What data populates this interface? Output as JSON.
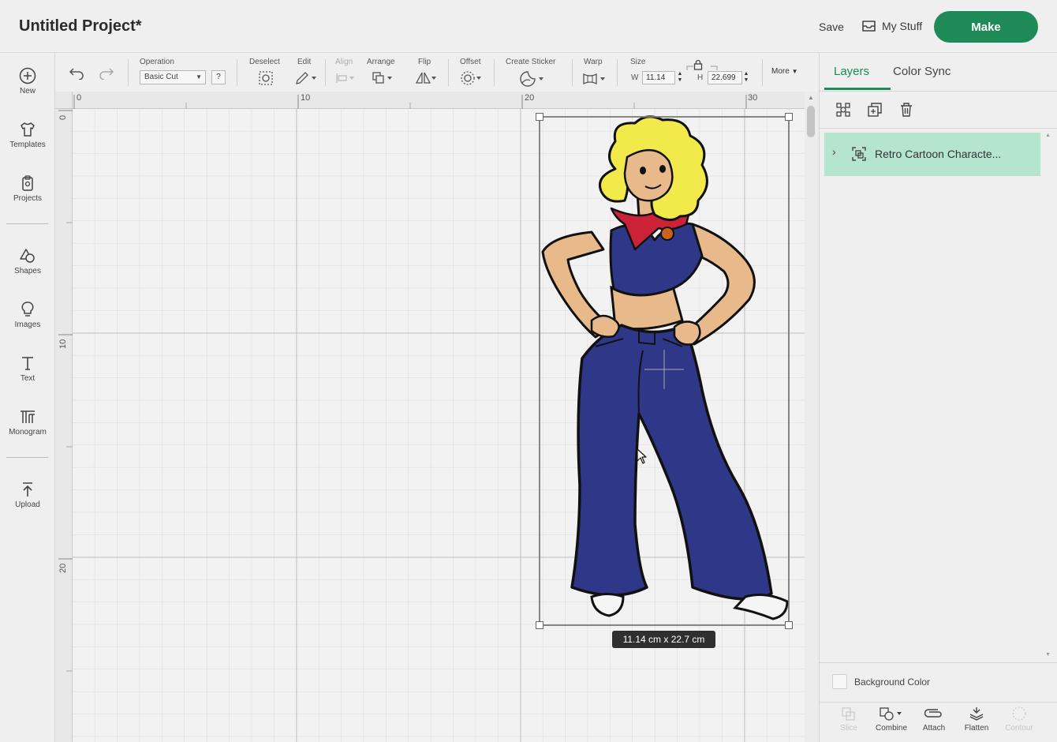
{
  "header": {
    "title": "Untitled Project*",
    "save_label": "Save",
    "mystuff_label": "My Stuff",
    "make_label": "Make",
    "accent_color": "#1d8a57"
  },
  "sidebar": {
    "items": [
      {
        "label": "New",
        "icon": "plus-circle-icon"
      },
      {
        "label": "Templates",
        "icon": "tshirt-icon"
      },
      {
        "label": "Projects",
        "icon": "clipboard-icon"
      },
      {
        "label": "Shapes",
        "icon": "shapes-icon"
      },
      {
        "label": "Images",
        "icon": "lightbulb-icon"
      },
      {
        "label": "Text",
        "icon": "text-t-icon"
      },
      {
        "label": "Monogram",
        "icon": "monogram-icon"
      },
      {
        "label": "Upload",
        "icon": "upload-icon"
      }
    ]
  },
  "toolbar": {
    "operation_label": "Operation",
    "operation_value": "Basic Cut",
    "help_label": "?",
    "deselect_label": "Deselect",
    "edit_label": "Edit",
    "align_label": "Align",
    "arrange_label": "Arrange",
    "flip_label": "Flip",
    "offset_label": "Offset",
    "create_sticker_label": "Create Sticker",
    "warp_label": "Warp",
    "size_label": "Size",
    "width_prefix": "W",
    "width_value": "11.14",
    "height_prefix": "H",
    "height_value": "22.699",
    "more_label": "More"
  },
  "canvas": {
    "ruler_top": [
      "0",
      "10",
      "20",
      "30"
    ],
    "ruler_left": [
      "0",
      "10",
      "20"
    ],
    "dimension_label": "11.14  cm x 22.7  cm",
    "selected_image": "retro-cartoon-character"
  },
  "layers_panel": {
    "tab_layers": "Layers",
    "tab_color_sync": "Color Sync",
    "layer_name": "Retro Cartoon Characte...",
    "layer_color": "#b5e4cf",
    "background_color_label": "Background Color",
    "bottom_tools": [
      {
        "label": "Slice",
        "enabled": false
      },
      {
        "label": "Combine",
        "enabled": true
      },
      {
        "label": "Attach",
        "enabled": true
      },
      {
        "label": "Flatten",
        "enabled": true
      },
      {
        "label": "Contour",
        "enabled": false
      }
    ]
  }
}
